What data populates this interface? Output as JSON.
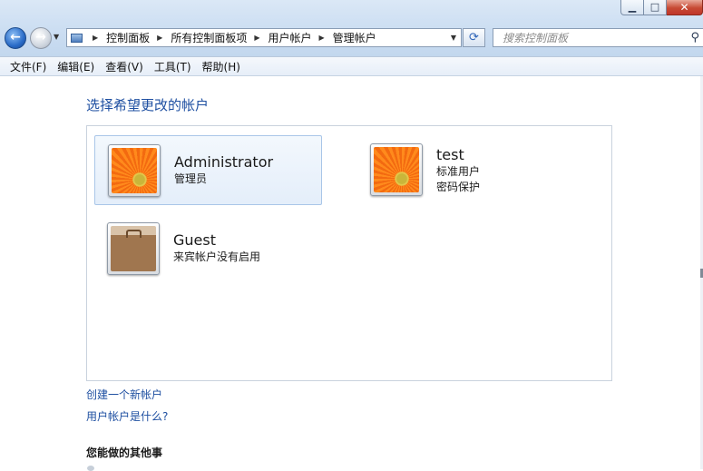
{
  "window": {
    "caption_buttons": {
      "minimize": "▁",
      "maximize": "□",
      "close": "✕"
    }
  },
  "navigation": {
    "back_glyph": "←",
    "forward_glyph": "→",
    "address": {
      "crumbs": [
        "控制面板",
        "所有控制面板项",
        "用户帐户",
        "管理帐户"
      ],
      "separator": "▶"
    },
    "refresh_glyph": "⟳",
    "search_placeholder": "搜索控制面板",
    "search_glyph": "⚲"
  },
  "menu": {
    "items": [
      "文件(F)",
      "编辑(E)",
      "查看(V)",
      "工具(T)",
      "帮助(H)"
    ]
  },
  "main": {
    "title": "选择希望更改的帐户",
    "accounts": [
      {
        "name": "Administrator",
        "lines": [
          "管理员"
        ],
        "picture": "flower-icon",
        "selected": true
      },
      {
        "name": "test",
        "lines": [
          "标准用户",
          "密码保护"
        ],
        "picture": "flower-icon",
        "selected": false
      },
      {
        "name": "Guest",
        "lines": [
          "来宾帐户没有启用"
        ],
        "picture": "briefcase-icon",
        "selected": false
      }
    ],
    "links": {
      "create": "创建一个新帐户",
      "what_is": "用户帐户是什么?"
    },
    "other_heading": "您能做的其他事"
  },
  "colors": {
    "link": "#1e4fa1",
    "selection_border": "#a9c6e8",
    "chrome": "#cfe0f3"
  }
}
